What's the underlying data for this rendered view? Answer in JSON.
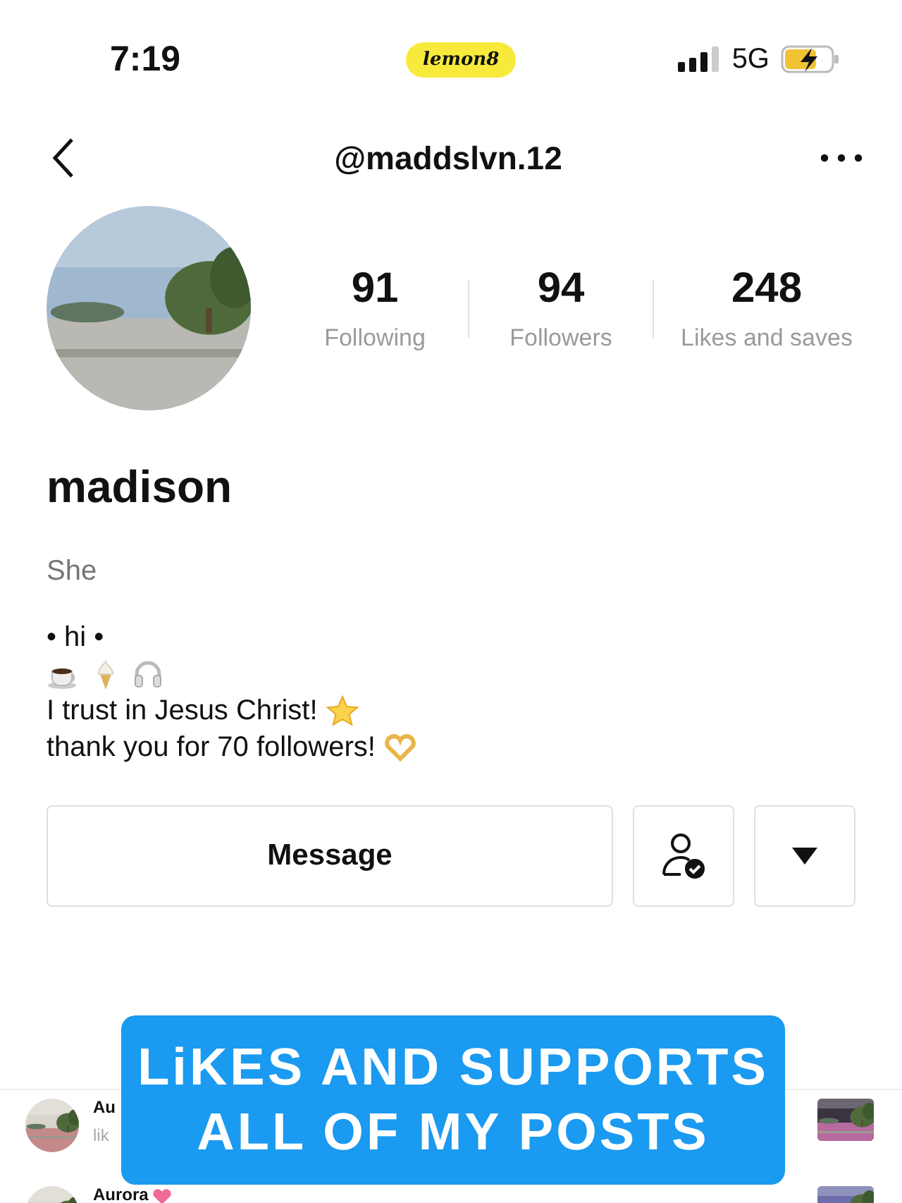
{
  "status_bar": {
    "time": "7:19",
    "app_badge": "lemon8",
    "network": "5G"
  },
  "header": {
    "username": "@maddslvn.12"
  },
  "profile": {
    "stats": [
      {
        "value": "91",
        "label": "Following"
      },
      {
        "value": "94",
        "label": "Followers"
      },
      {
        "value": "248",
        "label": "Likes and saves"
      }
    ],
    "name": "madison",
    "pronouns": "She",
    "bio": [
      {
        "kind": "plain",
        "text": "• hi •"
      },
      {
        "kind": "emoji-row"
      },
      {
        "kind": "star",
        "text": "I trust in Jesus Christ!"
      },
      {
        "kind": "heart",
        "text": "thank you for 70 followers!"
      }
    ]
  },
  "actions": {
    "message_button": "Message"
  },
  "list": [
    {
      "name": "Au",
      "subtitle": "lik",
      "heart": false
    },
    {
      "name": "Aurora",
      "heart": true
    }
  ],
  "banner": {
    "lines": [
      "LiKES AND SUPPORTS",
      "ALL OF MY POSTS"
    ]
  }
}
